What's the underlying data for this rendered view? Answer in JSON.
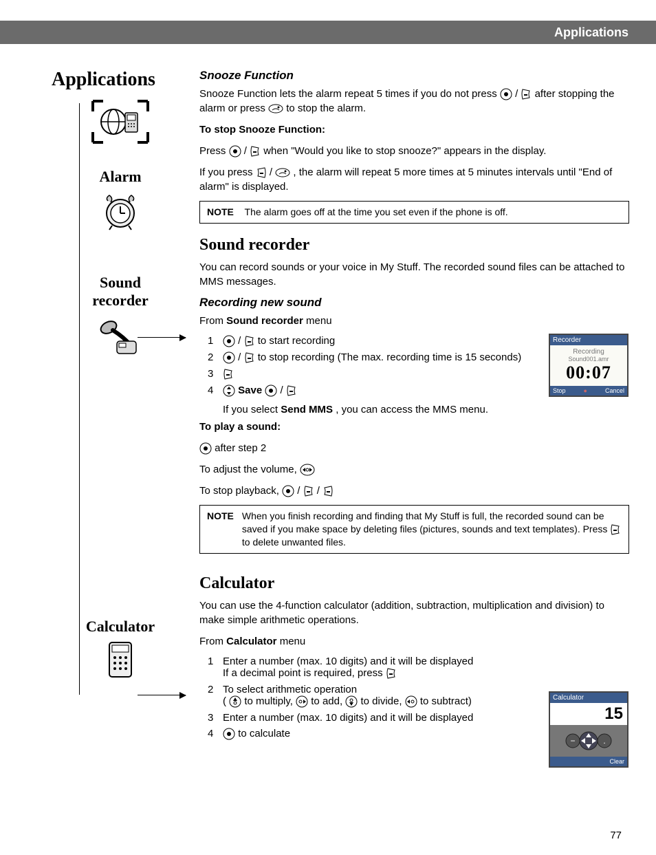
{
  "header": {
    "title": "Applications"
  },
  "sidebar": {
    "title": "Applications",
    "alarm_label": "Alarm",
    "sound_recorder_label_1": "Sound",
    "sound_recorder_label_2": "recorder",
    "calculator_label": "Calculator"
  },
  "snooze": {
    "heading": "Snooze Function",
    "desc_part1": "Snooze Function lets the alarm repeat 5 times if you do not press ",
    "desc_part2": " / ",
    "desc_part3": " after stopping the alarm or press ",
    "desc_part4": " to stop the alarm.",
    "stop_heading": "To stop Snooze Function:",
    "press_text_1": "Press ",
    "press_text_2": " / ",
    "press_text_3": " when \"Would you like to stop snooze?\" appears in the display.",
    "ifpress_1": "If you press ",
    "ifpress_2": " / ",
    "ifpress_3": ", the alarm will repeat 5 more times at 5 minutes intervals until \"End of alarm\" is displayed.",
    "note": "The alarm goes off at the time you set even if the phone is off."
  },
  "sound_recorder": {
    "heading": "Sound recorder",
    "intro": "You can record sounds or your voice in My Stuff. The recorded sound files can be attached to MMS messages.",
    "recording_heading": "Recording new sound",
    "from_menu_1": "From ",
    "from_menu_bold": "Sound recorder",
    "from_menu_2": " menu",
    "step1": " to start recording",
    "step2": " to stop recording (The max. recording time is 15 seconds)",
    "step4_save": "Save",
    "step4_after": "If you select ",
    "step4_bold": "Send MMS",
    "step4_end": ", you can access the MMS menu.",
    "play_heading": "To play a sound:",
    "play_step": " after step 2",
    "adjust_volume": "To adjust the volume, ",
    "stop_playback": "To stop playback, ",
    "note": "When you finish recording and finding that My Stuff is full, the recorded sound can be saved if you make space by deleting files (pictures, sounds and text templates). Press ",
    "note_end": " to delete unwanted files.",
    "screenshot": {
      "title": "Recorder",
      "line1": "Recording",
      "line2": "Sound001.amr",
      "time": "00:07",
      "left": "Stop",
      "right": "Cancel"
    }
  },
  "calculator": {
    "heading": "Calculator",
    "intro": "You can use the 4-function calculator (addition, subtraction, multiplication and division) to make simple arithmetic operations.",
    "from_menu_1": "From ",
    "from_menu_bold": "Calculator",
    "from_menu_2": " menu",
    "step1": "Enter a number (max. 10 digits) and it will be displayed",
    "step1_sub": "If a decimal point is required, press ",
    "step2": "To select arithmetic operation",
    "step2_sub_open": "( ",
    "step2_multiply": " to multiply, ",
    "step2_add": " to add, ",
    "step2_divide": " to divide, ",
    "step2_subtract": " to subtract)",
    "step3": "Enter a number (max. 10 digits) and it will be displayed",
    "step4": " to calculate",
    "screenshot": {
      "title": "Calculator",
      "value": "15",
      "right": "Clear"
    }
  },
  "note_label": "NOTE",
  "page_number": "77"
}
